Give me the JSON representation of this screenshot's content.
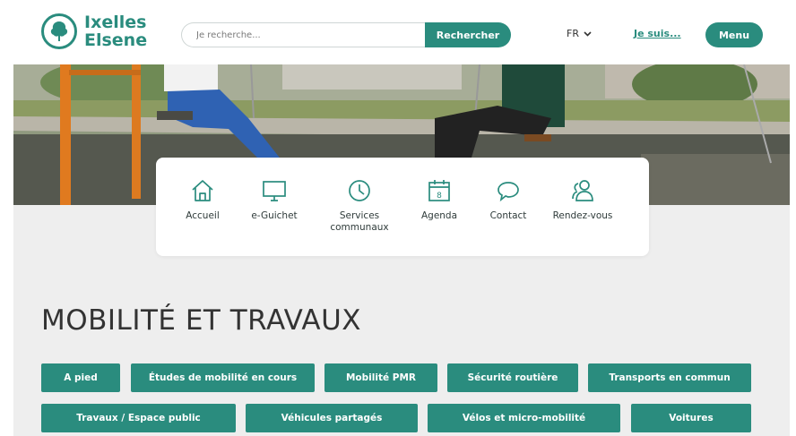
{
  "header": {
    "logo": {
      "line1": "Ixelles",
      "line2": "Elsene"
    },
    "search": {
      "placeholder": "Je recherche...",
      "button_label": "Rechercher"
    },
    "language": "FR",
    "je_suis_label": "Je suis...",
    "menu_label": "Menu"
  },
  "quick_links": [
    {
      "label": "Accueil",
      "icon": "home-icon"
    },
    {
      "label": "e-Guichet",
      "icon": "monitor-icon"
    },
    {
      "label": "Services communaux",
      "icon": "clock-icon"
    },
    {
      "label": "Agenda",
      "icon": "calendar-icon",
      "calendar_day": "8"
    },
    {
      "label": "Contact",
      "icon": "chat-icon"
    },
    {
      "label": "Rendez-vous",
      "icon": "users-icon"
    }
  ],
  "page_title": "MOBILITÉ ET TRAVAUX",
  "categories_row1": [
    "A pied",
    "Études de mobilité en cours",
    "Mobilité PMR",
    "Sécurité routière",
    "Transports en commun"
  ],
  "categories_row2": [
    "Travaux / Espace public",
    "Véhicules partagés",
    "Vélos et micro-mobilité",
    "Voitures"
  ],
  "colors": {
    "accent": "#2a8c7e",
    "background_grey": "#eeeeee"
  }
}
